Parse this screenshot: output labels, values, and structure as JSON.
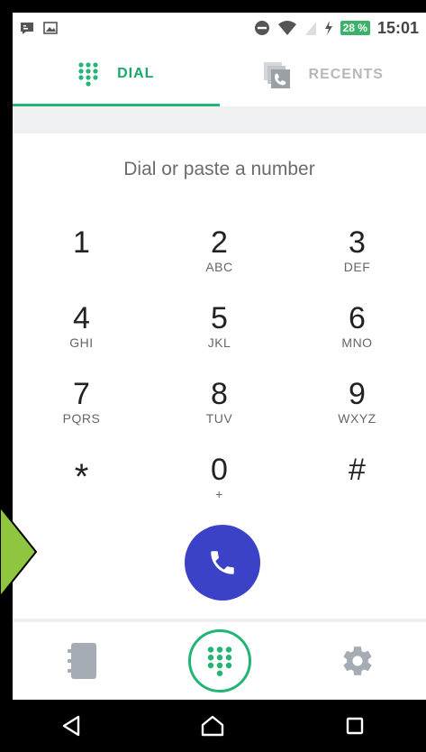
{
  "statusbar": {
    "battery": "28 %",
    "time": "15:01"
  },
  "tabs": [
    {
      "label": "DIAL",
      "active": true,
      "icon": "dialpad-icon"
    },
    {
      "label": "RECENTS",
      "active": false,
      "icon": "recents-icon"
    }
  ],
  "display": {
    "placeholder": "Dial or paste a number",
    "value": ""
  },
  "keypad": [
    [
      {
        "digit": "1",
        "letters": ""
      },
      {
        "digit": "2",
        "letters": "ABC"
      },
      {
        "digit": "3",
        "letters": "DEF"
      }
    ],
    [
      {
        "digit": "4",
        "letters": "GHI"
      },
      {
        "digit": "5",
        "letters": "JKL"
      },
      {
        "digit": "6",
        "letters": "MNO"
      }
    ],
    [
      {
        "digit": "7",
        "letters": "PQRS"
      },
      {
        "digit": "8",
        "letters": "TUV"
      },
      {
        "digit": "9",
        "letters": "WXYZ"
      }
    ],
    [
      {
        "digit": "*",
        "letters": ""
      },
      {
        "digit": "0",
        "letters": "+"
      },
      {
        "digit": "#",
        "letters": ""
      }
    ]
  ],
  "colors": {
    "accent": "#22b573",
    "call_button": "#3c42c8",
    "arrow": "#8fc63f"
  },
  "bottomnav": [
    {
      "icon": "contacts-icon"
    },
    {
      "icon": "dialpad-icon"
    },
    {
      "icon": "settings-icon"
    }
  ],
  "sysnav": [
    {
      "icon": "back-icon"
    },
    {
      "icon": "home-icon"
    },
    {
      "icon": "recents-square-icon"
    }
  ]
}
